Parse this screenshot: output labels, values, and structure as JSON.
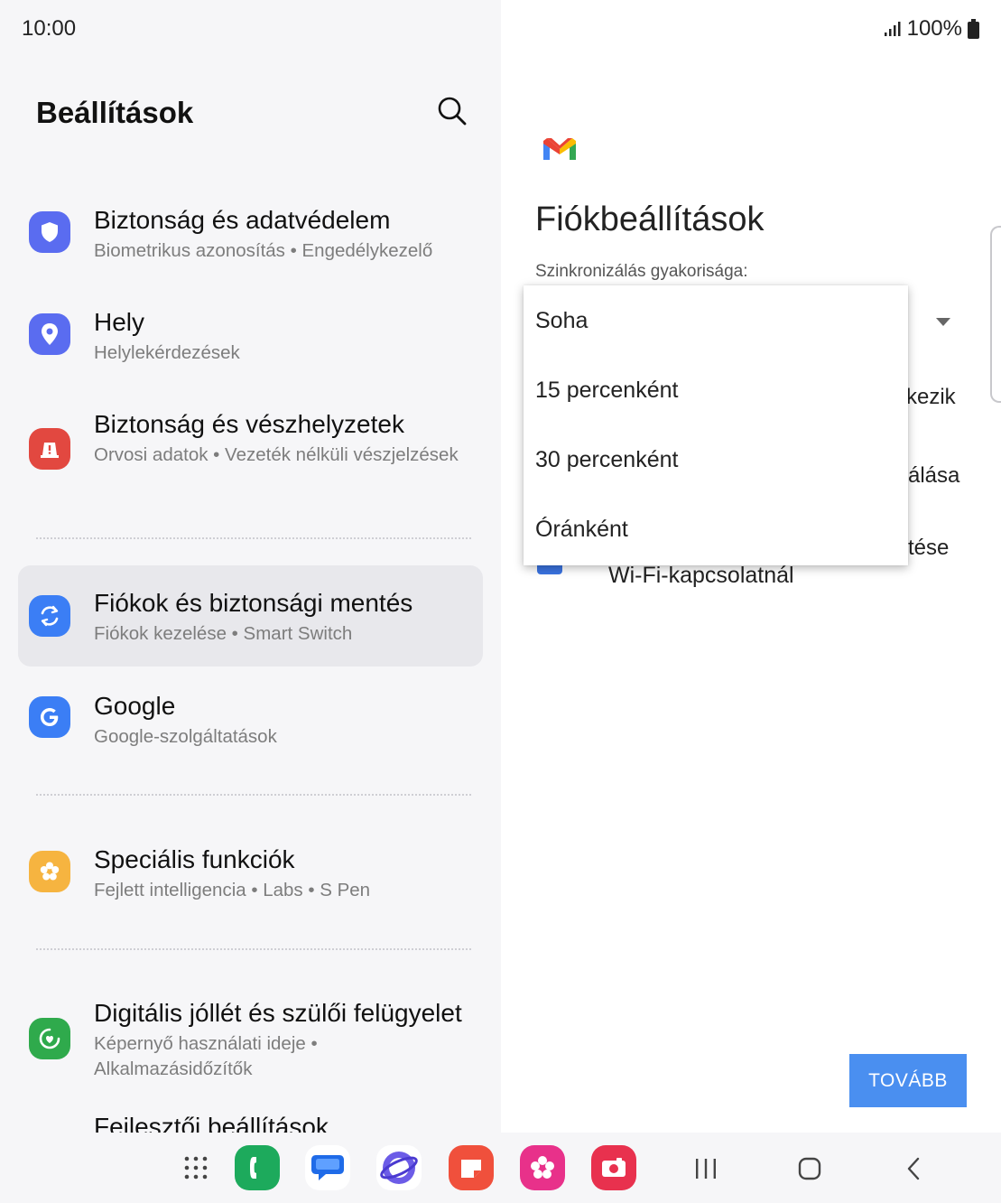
{
  "status": {
    "time": "10:00",
    "battery": "100%"
  },
  "settings": {
    "title": "Beállítások",
    "items": [
      {
        "title": "Biztonság és adatvédelem",
        "subtitle": "Biometrikus azonosítás  •  Engedélykezelő",
        "icon": "shield-icon",
        "color": "#5a6cf0"
      },
      {
        "title": "Hely",
        "subtitle": "Helylekérdezések",
        "icon": "location-pin-icon",
        "color": "#5a6cf0"
      },
      {
        "title": "Biztonság és vészhelyzetek",
        "subtitle": "Orvosi adatok  •  Vezeték nélküli vészjelzések",
        "icon": "emergency-icon",
        "color": "#e24840"
      },
      {
        "title": "Fiókok és biztonsági mentés",
        "subtitle": "Fiókok kezelése  •  Smart Switch",
        "icon": "sync-icon",
        "color": "#3b7ef5"
      },
      {
        "title": "Google",
        "subtitle": "Google-szolgáltatások",
        "icon": "google-icon",
        "color": "#3b7ef5"
      },
      {
        "title": "Speciális funkciók",
        "subtitle": "Fejlett intelligencia  •  Labs  •  S Pen",
        "icon": "flower-gear-icon",
        "color": "#f6b440"
      },
      {
        "title": "Digitális jóllét és szülői felügyelet",
        "subtitle": "Képernyő használati ideje  •  Alkalmazásidőzítők",
        "icon": "wellbeing-icon",
        "color": "#2faa4c"
      }
    ],
    "partial_item": "Fejlesztői beállítások"
  },
  "account": {
    "title": "Fiókbeállítások",
    "sync_label": "Szinkronizálás gyakorisága:",
    "options": [
      "Soha",
      "15 percenként",
      "30 percenként",
      "Óránként"
    ],
    "bg_fragments": [
      "kezik",
      "álása",
      "tése"
    ],
    "wifi_option": "Wi-Fi-kapcsolatnál",
    "next_button": "TOVÁBB"
  },
  "nav_apps": [
    "apps-grid-icon",
    "phone-icon",
    "messages-icon",
    "internet-icon",
    "notes-icon",
    "gallery-icon",
    "camera-icon"
  ],
  "colors": {
    "accent": "#4a8ff0",
    "selected": "#e8e8ec"
  }
}
